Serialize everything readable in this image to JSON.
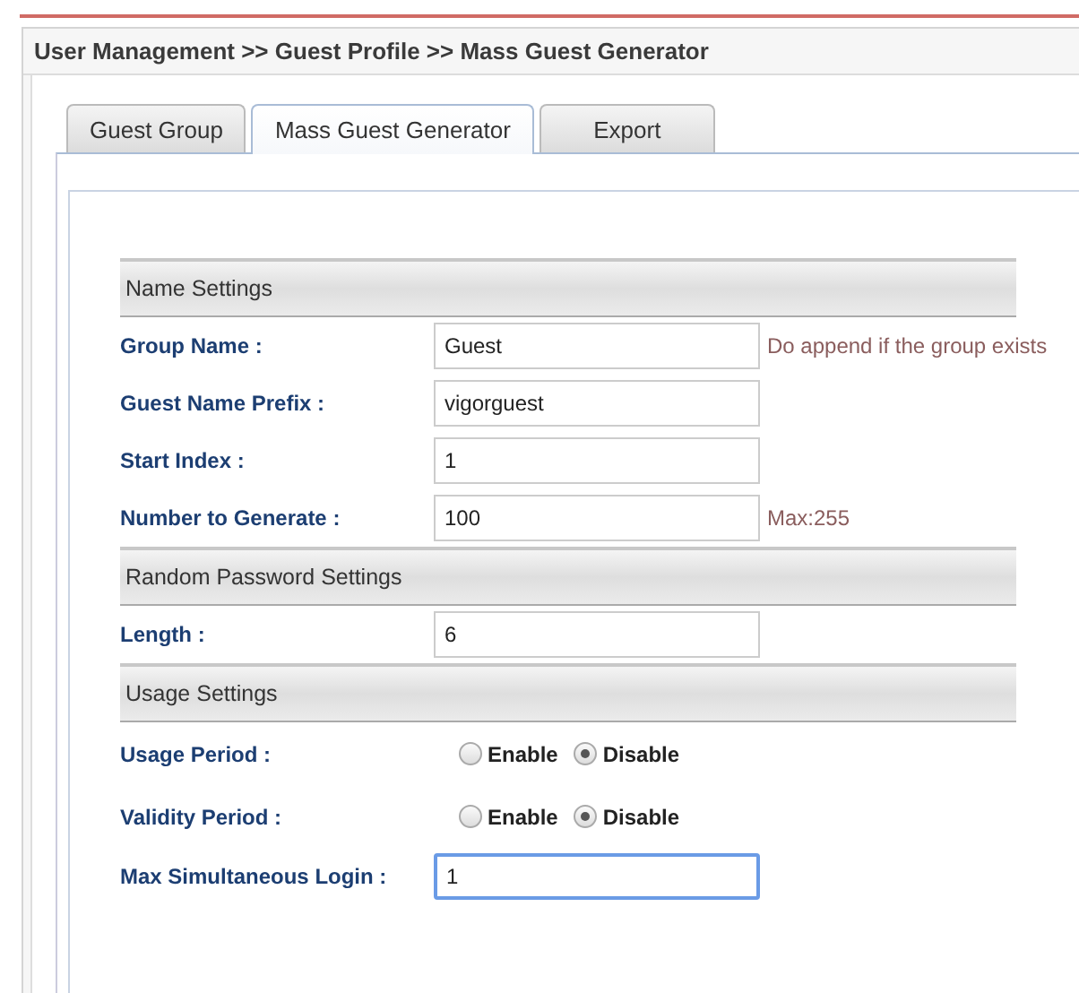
{
  "breadcrumb": "User Management >> Guest Profile >> Mass Guest Generator",
  "tabs": [
    {
      "label": "Guest Group",
      "selected": false
    },
    {
      "label": "Mass Guest Generator",
      "selected": true
    },
    {
      "label": "Export",
      "selected": false
    }
  ],
  "sections": [
    {
      "title": "Name Settings",
      "rows": [
        {
          "kind": "text",
          "label": "Group Name :",
          "value": "Guest",
          "hint": "Do append if the group exists"
        },
        {
          "kind": "text",
          "label": "Guest Name Prefix :",
          "value": "vigorguest"
        },
        {
          "kind": "text",
          "label": "Start Index :",
          "value": "1"
        },
        {
          "kind": "text",
          "label": "Number to Generate :",
          "value": "100",
          "hint": "Max:255"
        }
      ]
    },
    {
      "title": "Random Password Settings",
      "rows": [
        {
          "kind": "text",
          "label": "Length :",
          "value": "6"
        }
      ]
    },
    {
      "title": "Usage Settings",
      "rows": [
        {
          "kind": "radio",
          "label": "Usage Period :",
          "options": [
            {
              "label": "Enable",
              "selected": false
            },
            {
              "label": "Disable",
              "selected": true
            }
          ]
        },
        {
          "kind": "radio",
          "label": "Validity Period :",
          "options": [
            {
              "label": "Enable",
              "selected": false
            },
            {
              "label": "Disable",
              "selected": true
            }
          ]
        },
        {
          "kind": "text",
          "label": "Max Simultaneous Login :",
          "value": "1",
          "focused": true
        }
      ]
    }
  ]
}
